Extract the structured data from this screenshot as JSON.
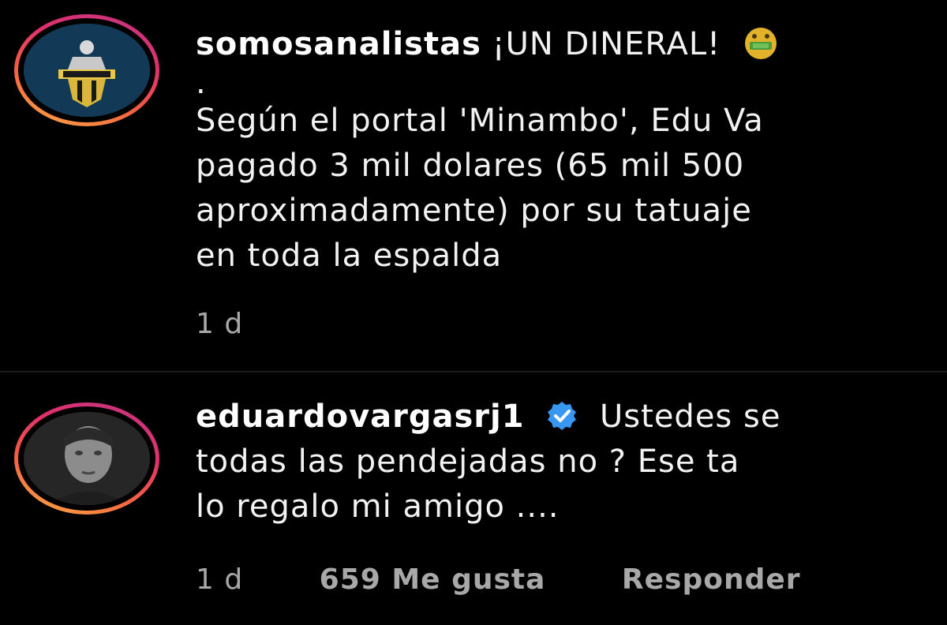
{
  "comments": [
    {
      "username": "somosanalistas",
      "lines": [
        "¡UN DINERAL!",
        ".",
        "Según el portal 'Minambo', Edu Va",
        "pagado 3 mil dolares (65 mil 500",
        "aproximadamente) por su tatuaje",
        "en toda la espalda"
      ],
      "emoji_icon": "money-mouth-face-icon",
      "time": "1 d"
    },
    {
      "username": "eduardovargasrj1",
      "verified_icon": "verified-badge-icon",
      "lines": [
        "Ustedes se",
        "todas las pendejadas no ? Ese ta",
        "lo regalo mi amigo ...."
      ],
      "time": "1 d",
      "likes": "659 Me gusta",
      "reply_label": "Responder"
    }
  ],
  "colors": {
    "background": "#000000",
    "text": "#f2f2f2",
    "meta_text": "#a8a8a8",
    "verified_blue": "#3897f0",
    "story_ring": [
      "#c13584",
      "#e1306c",
      "#f56040",
      "#fcaf45"
    ]
  }
}
